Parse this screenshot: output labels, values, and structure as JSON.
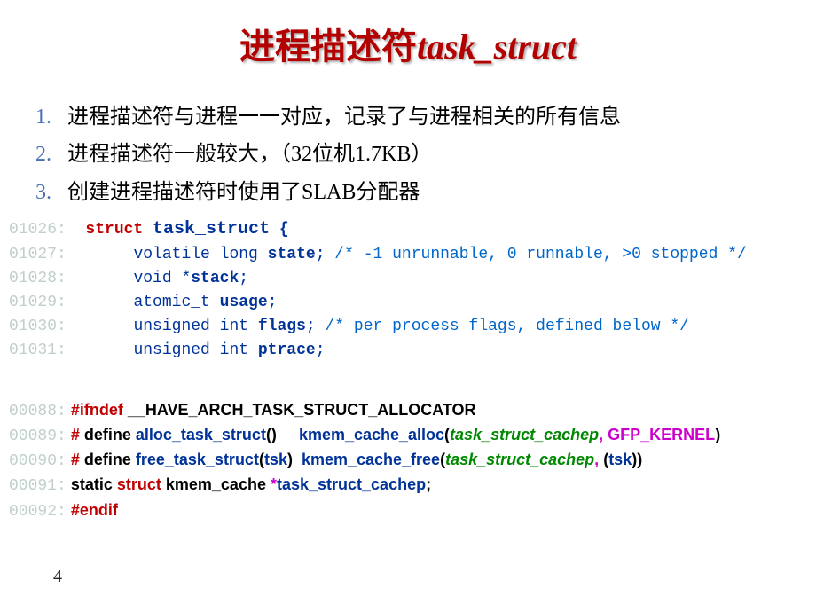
{
  "title": {
    "cn": "进程描述符",
    "en": "task_struct"
  },
  "bullets": [
    {
      "num": "1.",
      "text": "进程描述符与进程一一对应，记录了与进程相关的所有信息"
    },
    {
      "num": "2.",
      "text": "进程描述符一般较大，（32位机1.7KB）"
    },
    {
      "num": "3.",
      "text": "创建进程描述符时使用了SLAB分配器"
    }
  ],
  "code1": {
    "l1": {
      "ln": "01026:",
      "kw": "struct",
      "id": "task_struct",
      "br": " {"
    },
    "l2": {
      "ln": "01027:",
      "type": "volatile long ",
      "mem": "state",
      "semi": ";",
      "cmt": " /* -1 unrunnable, 0 runnable, >0 stopped */"
    },
    "l3": {
      "ln": "01028:",
      "type": "void *",
      "mem": "stack",
      "semi": ";"
    },
    "l4": {
      "ln": "01029:",
      "type": "atomic_t ",
      "mem": "usage",
      "semi": ";"
    },
    "l5": {
      "ln": "01030:",
      "type": "unsigned int ",
      "mem": "flags",
      "semi": ";",
      "cmt": " /* per process flags, defined below */"
    },
    "l6": {
      "ln": "01031:",
      "type": "unsigned int ",
      "mem": "ptrace",
      "semi": ";"
    }
  },
  "code2": {
    "l1": {
      "ln": "00088:",
      "pp": "#ifndef ",
      "macro": "__HAVE_ARCH_TASK_STRUCT_ALLOCATOR"
    },
    "l2": {
      "ln": "00089:",
      "pp": "#",
      "def": " define ",
      "fn": "alloc_task_struct",
      "p1": "()     ",
      "call": "kmem_cache_alloc",
      "po": "(",
      "a1": "task_struct_cachep",
      "c1": ", ",
      "a2": "GFP_KERNEL",
      "pc": ")"
    },
    "l3": {
      "ln": "00090:",
      "pp": "#",
      "def": " define ",
      "fn": "free_task_struct",
      "po": "(",
      "prm": "tsk",
      "pc": ")  ",
      "call": "kmem_cache_free",
      "po2": "(",
      "a1": "task_struct_cachep",
      "c1": ", ",
      "po3": "(",
      "a2": "tsk",
      "pc3": ")",
      "pc2": ")"
    },
    "l4": {
      "ln": "00091:",
      "kw1": "static ",
      "kw2": "struct ",
      "ty": "kmem_cache ",
      "star": "*",
      "var": "task_struct_cachep",
      "semi": ";"
    },
    "l5": {
      "ln": "00092:",
      "pp": "#endif"
    }
  },
  "slideNumber": "4"
}
